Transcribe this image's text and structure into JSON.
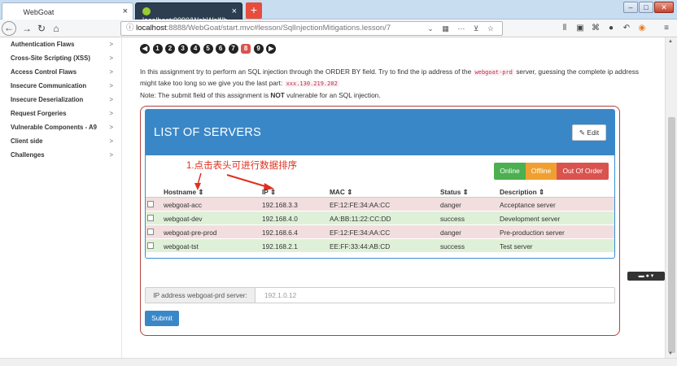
{
  "browser": {
    "tabs": [
      {
        "label": "WebGoat"
      },
      {
        "label": "localhost:9090/WebWolf/h..."
      }
    ],
    "new_tab": "+",
    "url_host": "localhost",
    "url_rest": ":8888/WebGoat/start.mvc#lesson/SqlInjectionMitigations.lesson/7",
    "url_icons": "⌄ ▦ ⋯ ⊻ ☆"
  },
  "sidebar": {
    "items": [
      {
        "label": "Authentication Flaws"
      },
      {
        "label": "Cross-Site Scripting (XSS)"
      },
      {
        "label": "Access Control Flaws"
      },
      {
        "label": "Insecure Communication"
      },
      {
        "label": "Insecure Deserialization"
      },
      {
        "label": "Request Forgeries"
      },
      {
        "label": "Vulnerable Components - A9"
      },
      {
        "label": "Client side"
      },
      {
        "label": "Challenges"
      }
    ],
    "chevron": ">"
  },
  "pagination": {
    "pages": [
      "1",
      "2",
      "3",
      "4",
      "5",
      "6",
      "7",
      "8",
      "9"
    ],
    "current": "8"
  },
  "lesson": {
    "instruction_part1": "In this assignment try to perform an SQL injection through the ORDER BY field. Try to find the ip address of the ",
    "instruction_code1": "webgoat-prd",
    "instruction_part2": " server, guessing the complete ip address might take too long so we give you the last part: ",
    "instruction_code2": "xxx.130.219.202",
    "note_prefix": "Note: The submit field of this assignment is ",
    "note_bold": "NOT",
    "note_suffix": " vulnerable for an SQL injection."
  },
  "panel": {
    "title": "LIST OF SERVERS",
    "edit_label": "Edit",
    "annotation": "1.点击表头可进行数据排序",
    "legend": {
      "online": "Online",
      "offline": "Offline",
      "out_of_order": "Out Of Order"
    }
  },
  "table": {
    "headers": {
      "hostname": "Hostname ⇕",
      "ip": "IP ⇕",
      "mac": "MAC ⇕",
      "status": "Status ⇕",
      "description": "Description ⇕"
    },
    "rows": [
      {
        "hostname": "webgoat-acc",
        "ip": "192.168.3.3",
        "mac": "EF:12:FE:34:AA:CC",
        "status": "danger",
        "description": "Acceptance server"
      },
      {
        "hostname": "webgoat-dev",
        "ip": "192.168.4.0",
        "mac": "AA:BB:11:22:CC:DD",
        "status": "success",
        "description": "Development server"
      },
      {
        "hostname": "webgoat-pre-prod",
        "ip": "192.168.6.4",
        "mac": "EF:12:FE:34:AA:CC",
        "status": "danger",
        "description": "Pre-production server"
      },
      {
        "hostname": "webgoat-tst",
        "ip": "192.168.2.1",
        "mac": "EE:FF:33:44:AB:CD",
        "status": "success",
        "description": "Test server"
      }
    ]
  },
  "form": {
    "ip_label": "IP address webgoat-prd server:",
    "ip_value": "192.1.0.12",
    "submit_label": "Submit"
  },
  "colors": {
    "panel_header": "#3a87c8",
    "danger_row": "#f2dede",
    "success_row": "#dff0d8",
    "online": "#4caf50",
    "offline": "#f0a030",
    "out_of_order": "#d9534f",
    "annotation": "#e0301e"
  }
}
